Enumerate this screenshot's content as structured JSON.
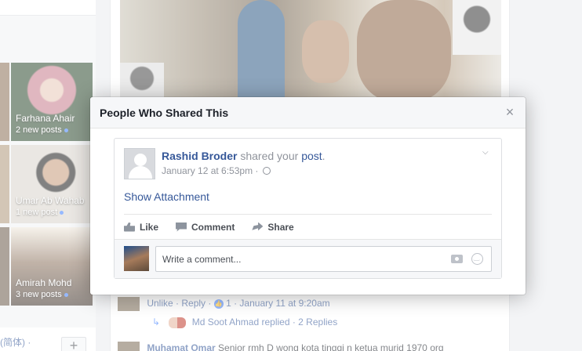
{
  "sidebar": {
    "friends": [
      {
        "name": "Farhana Ahair",
        "posts": "2 new posts"
      },
      {
        "name": "Umar Ab Wahab",
        "posts": "1 new post"
      },
      {
        "name": "Amirah Mohd",
        "posts": "3 new posts"
      }
    ],
    "language_text": "(简体) ·",
    "plus_label": "+"
  },
  "feed": {
    "comment1": {
      "actions": "Unlike · Reply ·",
      "like_count": "1",
      "time": "· January 11 at 9:20am"
    },
    "reply_summary": {
      "replier": "Md Soot Ahmad",
      "text": "replied · 2 Replies"
    },
    "comment2": {
      "author": "Muhamat Omar",
      "text": "Senior rmh D wong kota tinggi n ketua murid 1970 org"
    }
  },
  "dialog": {
    "title": "People Who Shared This",
    "close_glyph": "×",
    "story": {
      "author": "Rashid Broder",
      "action_text": " shared your ",
      "post_link": "post",
      "suffix": ".",
      "time": "January 12 at 6:53pm · ",
      "show_attachment": "Show Attachment",
      "actions": {
        "like": "Like",
        "comment": "Comment",
        "share": "Share"
      },
      "comment_placeholder": "Write a comment..."
    }
  },
  "icons": {
    "close": "close-icon",
    "chevron": "chevron-down-icon",
    "globe": "globe-icon",
    "like": "like-icon",
    "comment": "comment-icon",
    "share": "share-icon",
    "camera": "camera-icon",
    "emoji": "emoji-icon"
  },
  "colors": {
    "link": "#365899",
    "muted": "#90949c",
    "header_bg": "#f6f7f9"
  }
}
